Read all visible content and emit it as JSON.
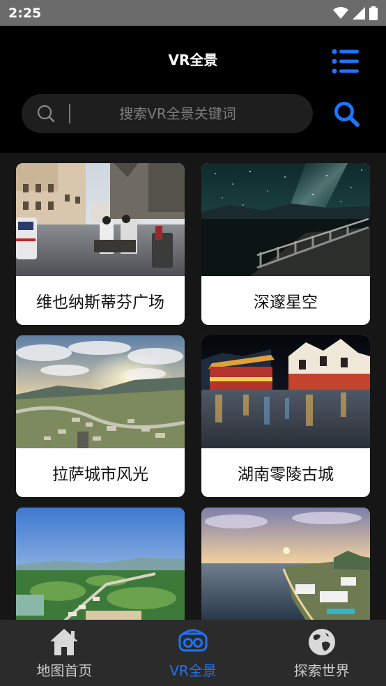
{
  "status": {
    "time": "2:25"
  },
  "header": {
    "title": "VR全景"
  },
  "search": {
    "placeholder": "搜索VR全景关键词"
  },
  "panoramas": [
    {
      "title": "维也纳斯蒂芬广场"
    },
    {
      "title": "深邃星空"
    },
    {
      "title": "拉萨城市风光"
    },
    {
      "title": "湖南零陵古城"
    },
    {
      "title": ""
    },
    {
      "title": ""
    }
  ],
  "tabs": [
    {
      "label": "地图首页",
      "icon": "home-icon",
      "active": false
    },
    {
      "label": "VR全景",
      "icon": "vr-headset-icon",
      "active": true
    },
    {
      "label": "探索世界",
      "icon": "globe-icon",
      "active": false
    }
  ],
  "colors": {
    "accent": "#1e73ff",
    "background": "#000000",
    "tab_bar": "#2b2b2b"
  }
}
